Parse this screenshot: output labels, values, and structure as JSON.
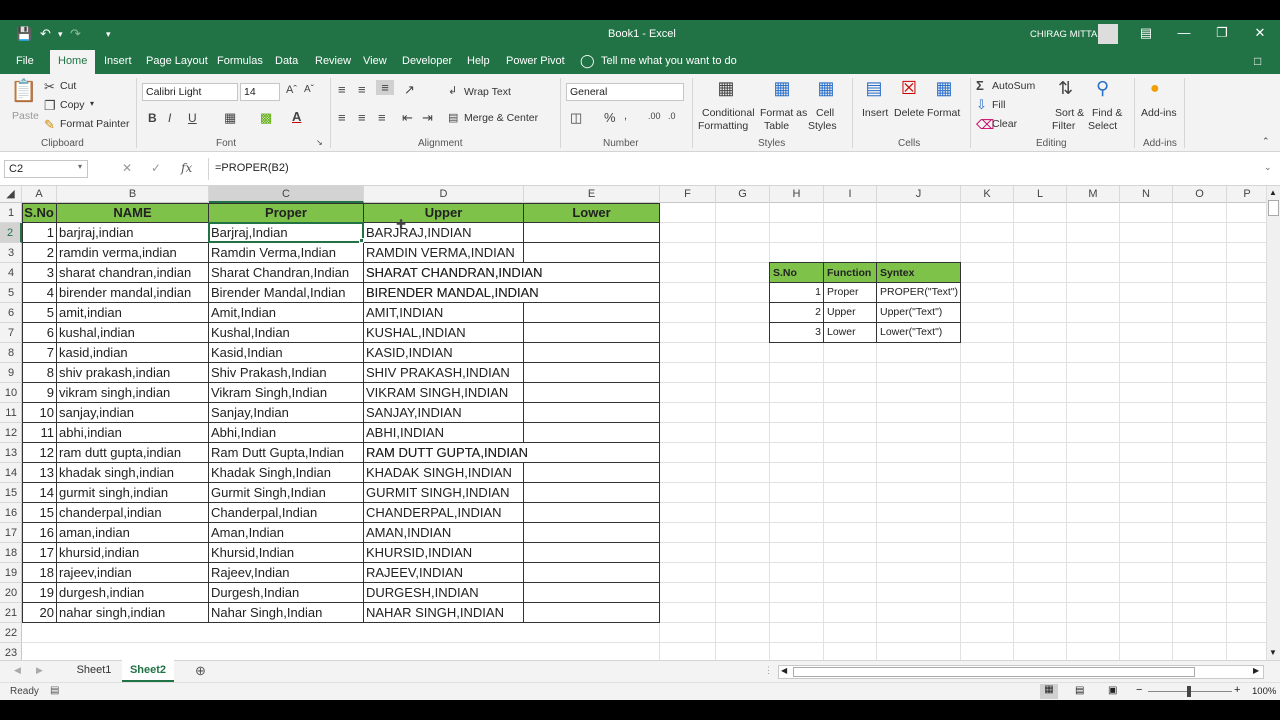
{
  "window": {
    "title": "Book1  -  Excel",
    "user": "CHIRAG MITTAL"
  },
  "tabs": [
    "File",
    "Home",
    "Insert",
    "Page Layout",
    "Formulas",
    "Data",
    "Review",
    "View",
    "Developer",
    "Help",
    "Power Pivot"
  ],
  "tell_me": "Tell me what you want to do",
  "ribbon": {
    "clipboard": {
      "paste": "Paste",
      "cut": "Cut",
      "copy": "Copy",
      "format_painter": "Format Painter",
      "group": "Clipboard"
    },
    "font": {
      "name": "Calibri Light",
      "size": "14",
      "bold": "B",
      "italic": "I",
      "underline": "U",
      "group": "Font"
    },
    "alignment": {
      "wrap": "Wrap Text",
      "merge": "Merge & Center",
      "group": "Alignment"
    },
    "number": {
      "format": "General",
      "group": "Number"
    },
    "styles": {
      "conditional_1": "Conditional",
      "conditional_2": "Formatting",
      "format_table_1": "Format as",
      "format_table_2": "Table",
      "cell_styles_1": "Cell",
      "cell_styles_2": "Styles",
      "group": "Styles"
    },
    "cells": {
      "insert": "Insert",
      "delete": "Delete",
      "format": "Format",
      "group": "Cells"
    },
    "editing": {
      "autosum": "AutoSum",
      "fill": "Fill",
      "clear": "Clear",
      "sort_1": "Sort &",
      "sort_2": "Filter",
      "find_1": "Find &",
      "find_2": "Select",
      "group": "Editing"
    },
    "addins": {
      "label": "Add-ins",
      "group": "Add-ins"
    }
  },
  "formula_bar": {
    "name_box": "C2",
    "fx": "fx",
    "formula": "=PROPER(B2)"
  },
  "columns": [
    "A",
    "B",
    "C",
    "D",
    "E",
    "F",
    "G",
    "H",
    "I",
    "J",
    "K",
    "L",
    "M",
    "N",
    "O",
    "P"
  ],
  "rows": [
    "1",
    "2",
    "3",
    "4",
    "5",
    "6",
    "7",
    "8",
    "9",
    "10",
    "11",
    "12",
    "13",
    "14",
    "15",
    "16",
    "17",
    "18",
    "19",
    "20",
    "21",
    "22",
    "23"
  ],
  "headers": {
    "sno": "S.No",
    "name": "NAME",
    "proper": "Proper",
    "upper": "Upper",
    "lower": "Lower"
  },
  "data": [
    {
      "n": "1",
      "name": "barjraj,indian",
      "proper": "Barjraj,Indian",
      "upper": "BARJRAJ,INDIAN"
    },
    {
      "n": "2",
      "name": "ramdin verma,indian",
      "proper": "Ramdin Verma,Indian",
      "upper": "RAMDIN VERMA,INDIAN"
    },
    {
      "n": "3",
      "name": "sharat chandran,indian",
      "proper": "Sharat Chandran,Indian",
      "upper": "SHARAT CHANDRAN,INDIAN"
    },
    {
      "n": "4",
      "name": "birender mandal,indian",
      "proper": "Birender Mandal,Indian",
      "upper": "BIRENDER MANDAL,INDIAN"
    },
    {
      "n": "5",
      "name": "amit,indian",
      "proper": "Amit,Indian",
      "upper": "AMIT,INDIAN"
    },
    {
      "n": "6",
      "name": "kushal,indian",
      "proper": "Kushal,Indian",
      "upper": "KUSHAL,INDIAN"
    },
    {
      "n": "7",
      "name": "kasid,indian",
      "proper": "Kasid,Indian",
      "upper": "KASID,INDIAN"
    },
    {
      "n": "8",
      "name": "shiv prakash,indian",
      "proper": "Shiv Prakash,Indian",
      "upper": "SHIV PRAKASH,INDIAN"
    },
    {
      "n": "9",
      "name": "vikram singh,indian",
      "proper": "Vikram Singh,Indian",
      "upper": "VIKRAM SINGH,INDIAN"
    },
    {
      "n": "10",
      "name": "sanjay,indian",
      "proper": "Sanjay,Indian",
      "upper": "SANJAY,INDIAN"
    },
    {
      "n": "11",
      "name": "abhi,indian",
      "proper": "Abhi,Indian",
      "upper": "ABHI,INDIAN"
    },
    {
      "n": "12",
      "name": "ram dutt gupta,indian",
      "proper": "Ram Dutt Gupta,Indian",
      "upper": "RAM DUTT GUPTA,INDIAN"
    },
    {
      "n": "13",
      "name": "khadak singh,indian",
      "proper": "Khadak Singh,Indian",
      "upper": "KHADAK SINGH,INDIAN"
    },
    {
      "n": "14",
      "name": "gurmit singh,indian",
      "proper": "Gurmit Singh,Indian",
      "upper": "GURMIT SINGH,INDIAN"
    },
    {
      "n": "15",
      "name": "chanderpal,indian",
      "proper": "Chanderpal,Indian",
      "upper": "CHANDERPAL,INDIAN"
    },
    {
      "n": "16",
      "name": "aman,indian",
      "proper": "Aman,Indian",
      "upper": "AMAN,INDIAN"
    },
    {
      "n": "17",
      "name": "khursid,indian",
      "proper": "Khursid,Indian",
      "upper": "KHURSID,INDIAN"
    },
    {
      "n": "18",
      "name": "rajeev,indian",
      "proper": "Rajeev,Indian",
      "upper": "RAJEEV,INDIAN"
    },
    {
      "n": "19",
      "name": "durgesh,indian",
      "proper": "Durgesh,Indian",
      "upper": "DURGESH,INDIAN"
    },
    {
      "n": "20",
      "name": "nahar singh,indian",
      "proper": "Nahar Singh,Indian",
      "upper": "NAHAR SINGH,INDIAN"
    }
  ],
  "ref_table": {
    "headers": [
      "S.No",
      "Function",
      "Syntex"
    ],
    "rows": [
      [
        "1",
        "Proper",
        "PROPER(\"Text\")"
      ],
      [
        "2",
        "Upper",
        "Upper(\"Text\")"
      ],
      [
        "3",
        "Lower",
        "Lower(\"Text\")"
      ]
    ]
  },
  "sheets": [
    "Sheet1",
    "Sheet2"
  ],
  "active_sheet": "Sheet2",
  "status": {
    "ready": "Ready",
    "zoom": "100%"
  },
  "colors": {
    "excel_green": "#217346",
    "header_fill": "#7fc24a"
  }
}
